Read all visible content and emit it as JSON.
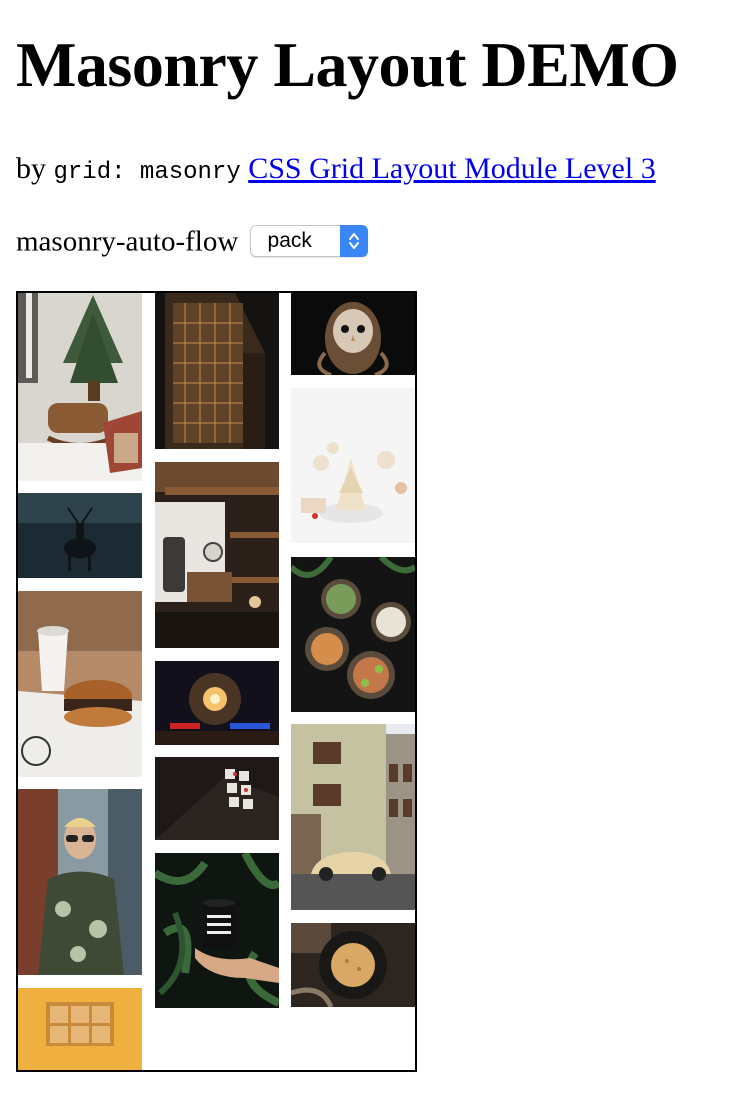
{
  "page": {
    "title": "Masonry Layout DEMO",
    "byline_prefix": "by",
    "byline_code": "grid: masonry",
    "byline_link": "CSS Grid Layout Module Level 3"
  },
  "controls": {
    "flow_label": "masonry-auto-flow",
    "flow_select_value": "pack",
    "flow_select_options": [
      "pack"
    ]
  },
  "gallery": {
    "columns": 3,
    "column_1": [
      "christmas-tree-rocking-horse",
      "deer-in-dark-forest",
      "burger-and-coffee-cup",
      "man-in-sunglasses-hoodie",
      "wooden-mailboxes-yellow"
    ],
    "column_2": [
      "skyscraper-at-night",
      "coffee-shop-shelves",
      "glowing-lantern",
      "buttons-on-dark",
      "coffee-before-content-cup"
    ],
    "column_3": [
      "barn-owl",
      "meringue-christmas-trees",
      "food-bowls",
      "vintage-car-building",
      "flatbread-on-plate"
    ]
  },
  "colors": {
    "link": "#0000ee",
    "select_arrow_bg": "#3b86f7",
    "grid_border": "#000000"
  }
}
